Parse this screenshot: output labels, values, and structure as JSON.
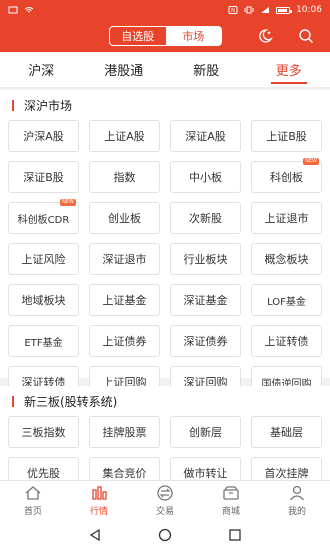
{
  "status_bar": {
    "time": "10:06"
  },
  "header": {
    "segments": [
      "自选股",
      "市场"
    ],
    "selected_segment": "市场",
    "icons": [
      "moon-star-icon",
      "search-icon"
    ]
  },
  "subtabs": [
    "沪深",
    "港股通",
    "新股",
    "更多"
  ],
  "active_subtab": "更多",
  "section_shsz": {
    "title": "深沪市场",
    "items": [
      {
        "label": "沪深A股"
      },
      {
        "label": "上证A股"
      },
      {
        "label": "深证A股"
      },
      {
        "label": "上证B股"
      },
      {
        "label": "深证B股"
      },
      {
        "label": "指数"
      },
      {
        "label": "中小板"
      },
      {
        "label": "科创板",
        "badge": "NEW"
      },
      {
        "label": "科创板CDR",
        "badge": "NEW"
      },
      {
        "label": "创业板"
      },
      {
        "label": "次新股"
      },
      {
        "label": "上证退市"
      },
      {
        "label": "上证风险"
      },
      {
        "label": "深证退市"
      },
      {
        "label": "行业板块"
      },
      {
        "label": "概念板块"
      },
      {
        "label": "地域板块"
      },
      {
        "label": "上证基金"
      },
      {
        "label": "深证基金"
      },
      {
        "label": "LOF基金"
      },
      {
        "label": "ETF基金"
      },
      {
        "label": "上证债券"
      },
      {
        "label": "深证债券"
      },
      {
        "label": "上证转债"
      },
      {
        "label": "深证转债"
      },
      {
        "label": "上证回购"
      },
      {
        "label": "深证回购"
      },
      {
        "label": "国债逆回购"
      }
    ]
  },
  "section_neeq": {
    "title": "新三板(股转系统)",
    "items": [
      {
        "label": "三板指数"
      },
      {
        "label": "挂牌股票"
      },
      {
        "label": "创新层"
      },
      {
        "label": "基础层"
      },
      {
        "label": "优先股"
      },
      {
        "label": "集合竞价"
      },
      {
        "label": "做市转让"
      },
      {
        "label": "首次挂牌"
      }
    ]
  },
  "bottom_nav": [
    {
      "label": "首页",
      "icon": "home-icon"
    },
    {
      "label": "行情",
      "icon": "quotes-icon"
    },
    {
      "label": "交易",
      "icon": "trade-icon"
    },
    {
      "label": "商城",
      "icon": "mall-icon"
    },
    {
      "label": "我的",
      "icon": "profile-icon"
    }
  ],
  "active_nav": "行情",
  "colors": {
    "accent": "#e8442c"
  }
}
